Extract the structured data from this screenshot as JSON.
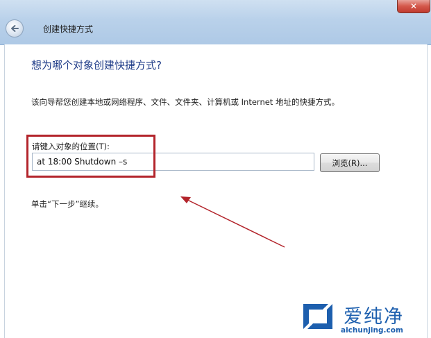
{
  "window": {
    "title": "创建快捷方式",
    "close_symbol": "✕"
  },
  "wizard": {
    "heading": "想为哪个对象创建快捷方式?",
    "description": "该向导帮您创建本地或网络程序、文件、文件夹、计算机或 Internet 地址的快捷方式。",
    "field_label": "请键入对象的位置(T):",
    "field_value": "at 18:00 Shutdown –s",
    "browse_label": "浏览(R)...",
    "hint": "单击“下一步”继续。"
  },
  "watermark": {
    "name": "爱纯净",
    "url": "aichunjing.com"
  },
  "icons": {
    "back": "back-arrow-icon",
    "close": "close-icon",
    "logo": "aichunjing-logo-icon"
  },
  "colors": {
    "heading": "#1f3c88",
    "highlight_box": "#b3242b",
    "annotation_arrow": "#b3242b",
    "close_button": "#c8473b",
    "logo": "#1d5fae"
  }
}
